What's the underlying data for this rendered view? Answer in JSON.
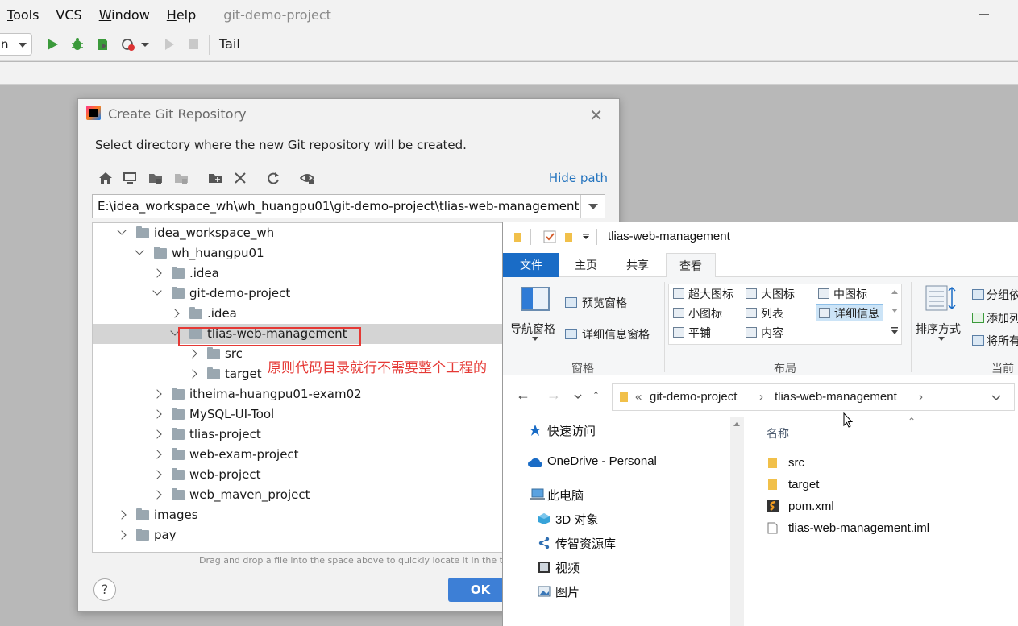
{
  "menubar": {
    "items": [
      {
        "label": "Tools",
        "underline": "T",
        "rest": "ools"
      },
      {
        "label": "VCS",
        "underline": "",
        "rest": "VCS"
      },
      {
        "label": "Window",
        "underline": "W",
        "rest": "indow"
      },
      {
        "label": "Help",
        "underline": "H",
        "rest": "elp"
      }
    ],
    "project_title": "git-demo-project"
  },
  "toolbar": {
    "run_config": "n",
    "tail_label": "Tail",
    "icons": [
      "run-icon",
      "debug-icon",
      "coverage-icon",
      "profiler-icon",
      "run-dropdown-icon",
      "build-icon",
      "stop-icon"
    ]
  },
  "dialog": {
    "title": "Create Git Repository",
    "description": "Select directory where the new Git repository will be created.",
    "hide_path": "Hide path",
    "path": "E:\\idea_workspace_wh\\wh_huangpu01\\git-demo-project\\tlias-web-management",
    "tree": [
      {
        "label": "idea_workspace_wh",
        "state": "expanded"
      },
      {
        "label": "wh_huangpu01",
        "state": "expanded"
      },
      {
        "label": ".idea",
        "state": "collapsed"
      },
      {
        "label": "git-demo-project",
        "state": "expanded"
      },
      {
        "label": ".idea",
        "state": "collapsed"
      },
      {
        "label": "tlias-web-management",
        "state": "expanded",
        "selected": true
      },
      {
        "label": "src",
        "state": "collapsed"
      },
      {
        "label": "target",
        "state": "collapsed"
      },
      {
        "label": "itheima-huangpu01-exam02",
        "state": "collapsed"
      },
      {
        "label": "MySQL-UI-Tool",
        "state": "collapsed"
      },
      {
        "label": "tlias-project",
        "state": "collapsed"
      },
      {
        "label": "web-exam-project",
        "state": "collapsed"
      },
      {
        "label": "web-project",
        "state": "collapsed"
      },
      {
        "label": "web_maven_project",
        "state": "collapsed"
      },
      {
        "label": "images",
        "state": "collapsed"
      },
      {
        "label": "pay",
        "state": "collapsed"
      }
    ],
    "annotation": "原则代码目录就行不需要整个工程的",
    "dnd_hint": "Drag and drop a file into the space above to quickly locate it in the tree",
    "help": "?",
    "ok": "OK"
  },
  "explorer": {
    "title": "tlias-web-management",
    "tabs": [
      "文件",
      "主页",
      "共享",
      "查看"
    ],
    "ribbon": {
      "nav_pane": "导航窗格",
      "preview_pane": "预览窗格",
      "details_pane": "详细信息窗格",
      "group_panes": "窗格",
      "layouts": [
        "超大图标",
        "大图标",
        "中图标",
        "小图标",
        "列表",
        "详细信息",
        "平铺",
        "内容"
      ],
      "group_layout": "布局",
      "sort_by": "排序方式",
      "group_by": "分组依",
      "add_column": "添加列",
      "fit_all": "将所有",
      "group_current": "当前"
    },
    "breadcrumb": [
      "«",
      "git-demo-project",
      "tlias-web-management"
    ],
    "nav_items": [
      "快速访问",
      "OneDrive - Personal",
      "此电脑",
      "3D 对象",
      "传智资源库",
      "视频",
      "图片"
    ],
    "column_name": "名称",
    "files": [
      {
        "name": "src",
        "type": "folder"
      },
      {
        "name": "target",
        "type": "folder"
      },
      {
        "name": "pom.xml",
        "type": "xml"
      },
      {
        "name": "tlias-web-management.iml",
        "type": "iml"
      }
    ]
  },
  "colors": {
    "accent": "#3d7fd6",
    "link": "#2675bf",
    "annotation": "#e53935",
    "explorer_file_tab": "#1a6cc6"
  }
}
